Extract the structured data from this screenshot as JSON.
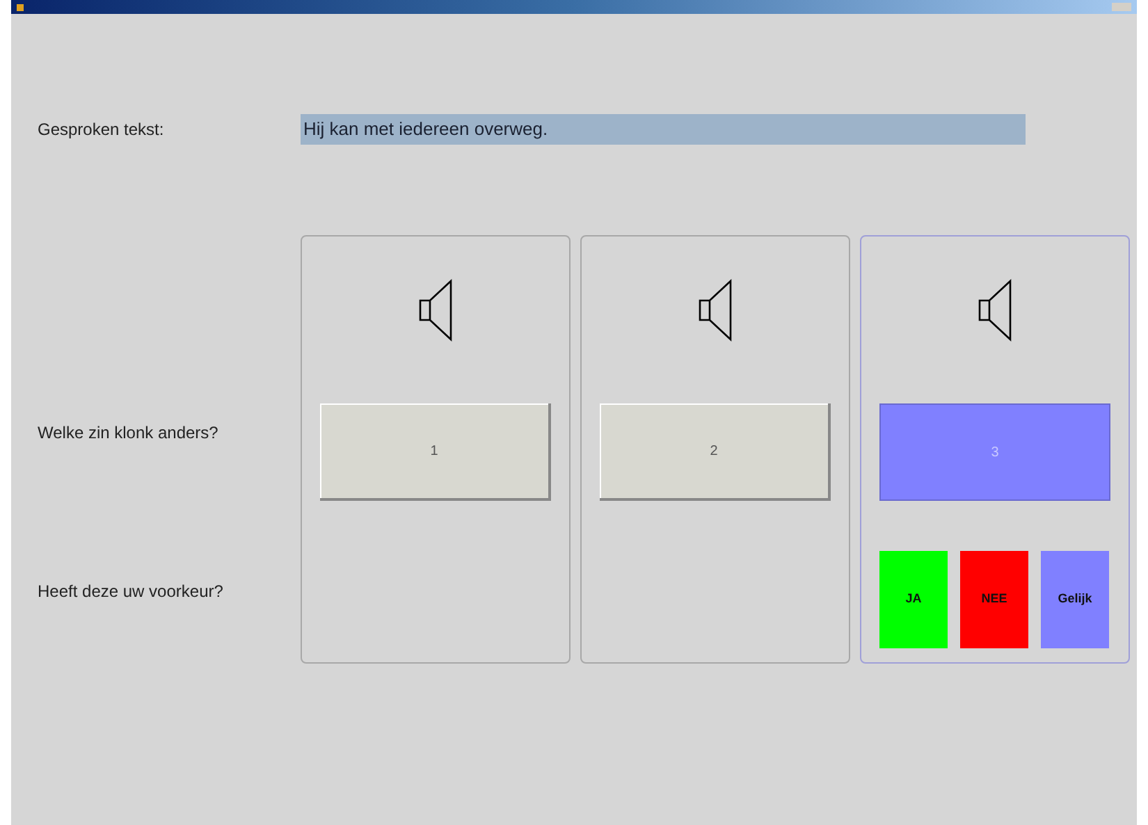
{
  "spoken": {
    "label": "Gesproken tekst:",
    "value": "Hij kan met iedereen overweg."
  },
  "questions": [
    "Welke zin klonk anders?",
    "Heeft deze uw voorkeur?"
  ],
  "options": [
    {
      "label": "1",
      "selected": false
    },
    {
      "label": "2",
      "selected": false
    },
    {
      "label": "3",
      "selected": true
    }
  ],
  "preference": [
    {
      "label": "JA",
      "color": "#00ff00"
    },
    {
      "label": "NEE",
      "color": "#ff0000"
    },
    {
      "label": "Gelijk",
      "color": "#8080ff"
    }
  ]
}
